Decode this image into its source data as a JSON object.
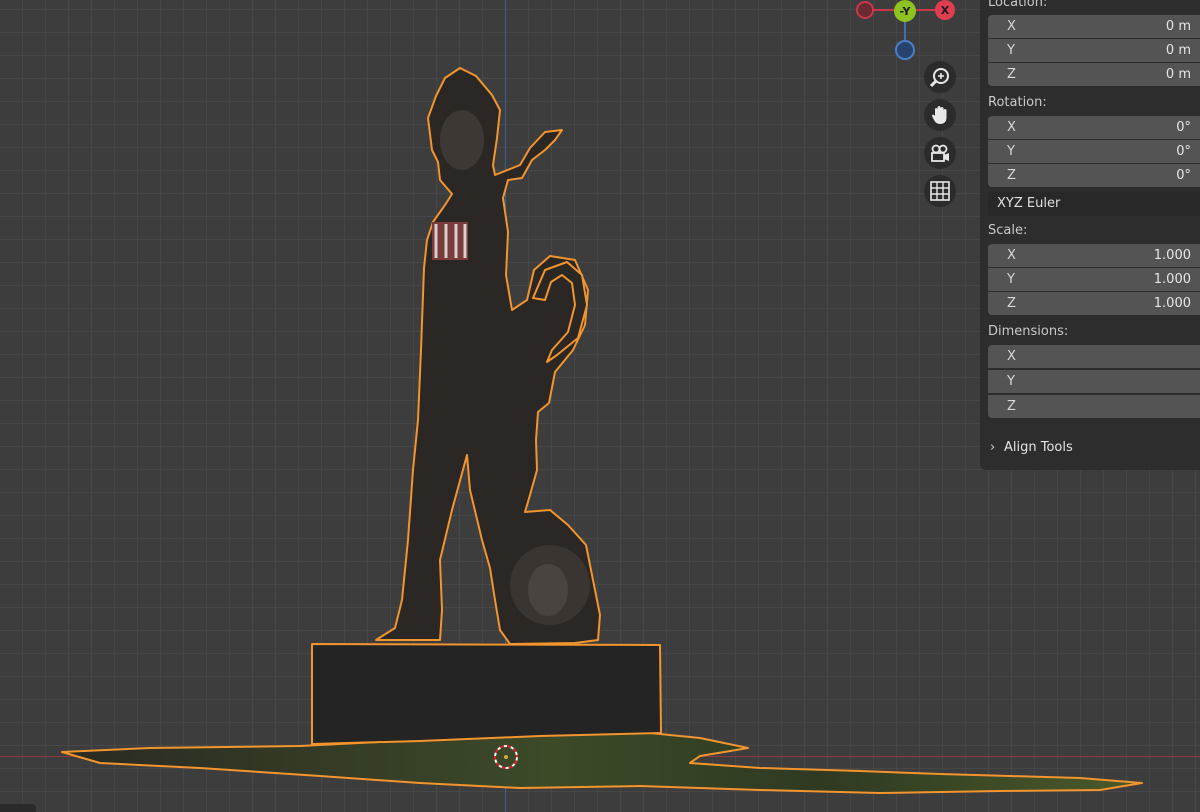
{
  "gizmo": {
    "neg_y_label": "-Y",
    "x_label": "X"
  },
  "nav": [
    "zoom-icon",
    "hand-pan-icon",
    "camera-icon",
    "grid-icon"
  ],
  "location": {
    "label": "Location:",
    "x": "0 m",
    "y": "0 m",
    "z": "0 m"
  },
  "rotation": {
    "label": "Rotation:",
    "x": "0°",
    "y": "0°",
    "z": "0°",
    "mode": "XYZ Euler"
  },
  "scale": {
    "label": "Scale:",
    "x": "1.000",
    "y": "1.000",
    "z": "1.000"
  },
  "dimensions": {
    "label": "Dimensions:",
    "x": "",
    "y": "",
    "z": ""
  },
  "axes": {
    "x": "X",
    "y": "Y",
    "z": "Z"
  },
  "align_tools": "Align Tools",
  "colors": {
    "selection_outline": "#f2952e",
    "x_axis": "#c9374a",
    "y_axis": "#8dc21f",
    "z_axis": "#3f6fb2"
  }
}
